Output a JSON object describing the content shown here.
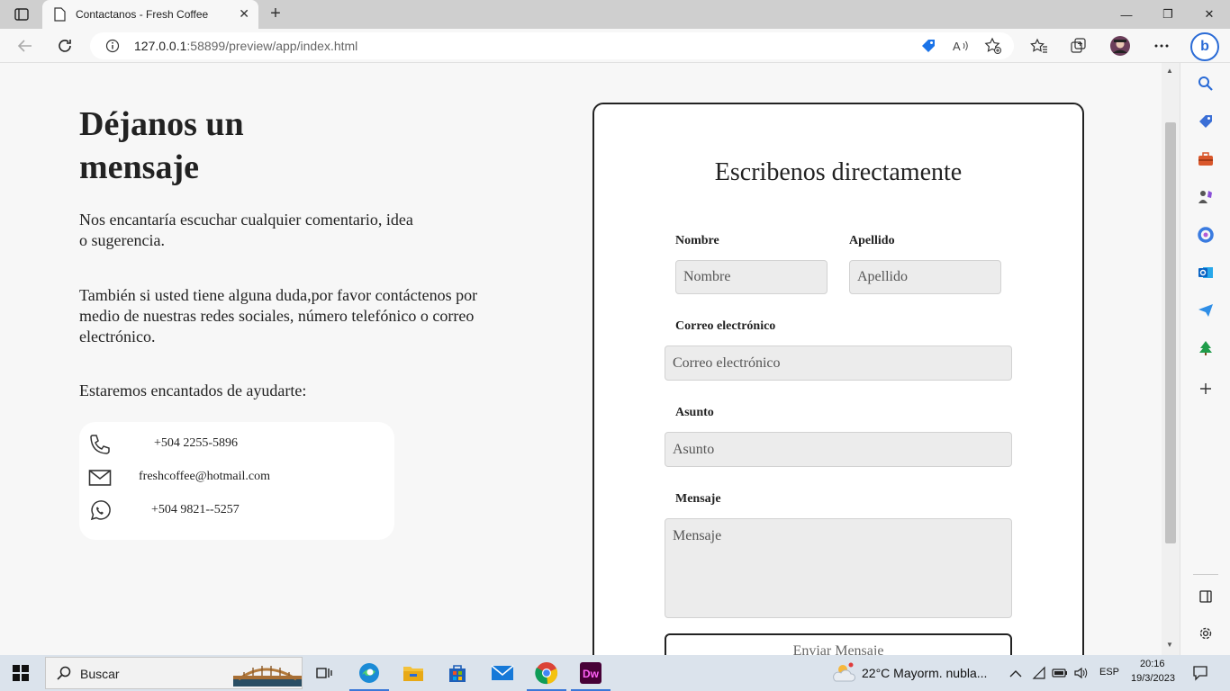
{
  "browser": {
    "tab_title": "Contactanos - Fresh Coffee",
    "url_host": "127.0.0.1",
    "url_rest": ":58899/preview/app/index.html"
  },
  "page": {
    "heading": "Déjanos un mensaje",
    "intro": "Nos encantaría escuchar cualquier comentario, idea o sugerencia.",
    "help_text": "También si usted tiene alguna duda,por favor contáctenos por medio de nuestras redes sociales, número telefónico o correo electrónico.",
    "closing": "Estaremos encantados de ayudarte:",
    "contacts": {
      "phone": "+504 2255-5896",
      "email": "freshcoffee@hotmail.com",
      "whatsapp": "+504 9821--5257"
    }
  },
  "form": {
    "title": "Escribenos directamente",
    "nombre_label": "Nombre",
    "nombre_placeholder": "Nombre",
    "apellido_label": "Apellido",
    "apellido_placeholder": "Apellido",
    "correo_label": "Correo electrónico",
    "correo_placeholder": "Correo electrónico",
    "asunto_label": "Asunto",
    "asunto_placeholder": "Asunto",
    "mensaje_label": "Mensaje",
    "mensaje_placeholder": "Mensaje",
    "submit_label": "Enviar Mensaje"
  },
  "taskbar": {
    "search_label": "Buscar",
    "weather": "22°C  Mayorm. nubla...",
    "language": "ESP",
    "time": "20:16",
    "date": "19/3/2023"
  }
}
